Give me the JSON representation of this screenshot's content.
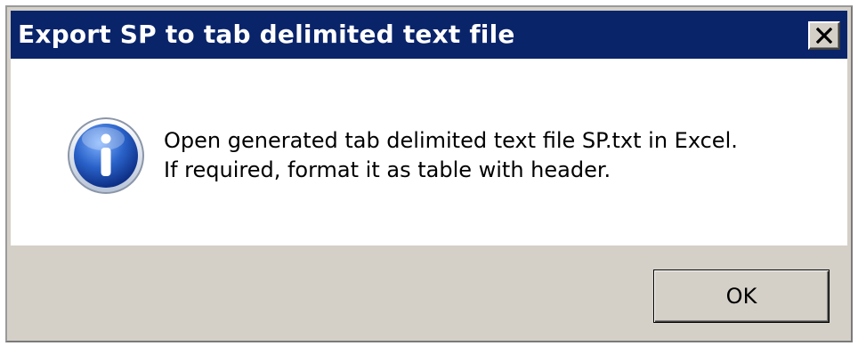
{
  "dialog": {
    "title": "Export SP to tab delimited text file",
    "close_icon": "close-icon",
    "icon": "info-icon",
    "message_lines": [
      "Open generated tab delimited text file SP.txt in Excel.",
      "If required, format it as table with header."
    ],
    "ok_label": "OK"
  },
  "colors": {
    "titlebar": "#0a246a",
    "title_text": "#ffffff",
    "face": "#d4d0c8",
    "content_bg": "#ffffff",
    "icon_blue": "#2a62c9"
  }
}
